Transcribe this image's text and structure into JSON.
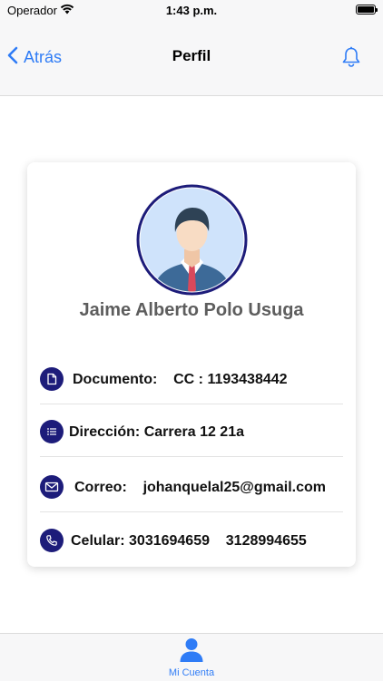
{
  "status_bar": {
    "carrier": "Operador",
    "time": "1:43 p.m."
  },
  "nav": {
    "back_label": "Atrás",
    "title": "Perfil"
  },
  "profile": {
    "name": "Jaime Alberto Polo Usuga",
    "rows": [
      {
        "icon": "document-icon",
        "text": "Documento:    CC : 1193438442"
      },
      {
        "icon": "list-icon",
        "text": "Dirección: Carrera 12 21a"
      },
      {
        "icon": "mail-icon",
        "text": "Correo:    johanquelal25@gmail.com"
      },
      {
        "icon": "phone-icon",
        "text": "Celular: 3031694659    3128994655"
      }
    ]
  },
  "tab_bar": {
    "items": [
      {
        "icon": "person-icon",
        "label": "Mi Cuenta",
        "active": true
      }
    ]
  },
  "colors": {
    "accent": "#2f7cf6",
    "icon_circle": "#1d1c7a",
    "avatar_border": "#1d1c7a",
    "name_text": "#5d5d5d"
  }
}
